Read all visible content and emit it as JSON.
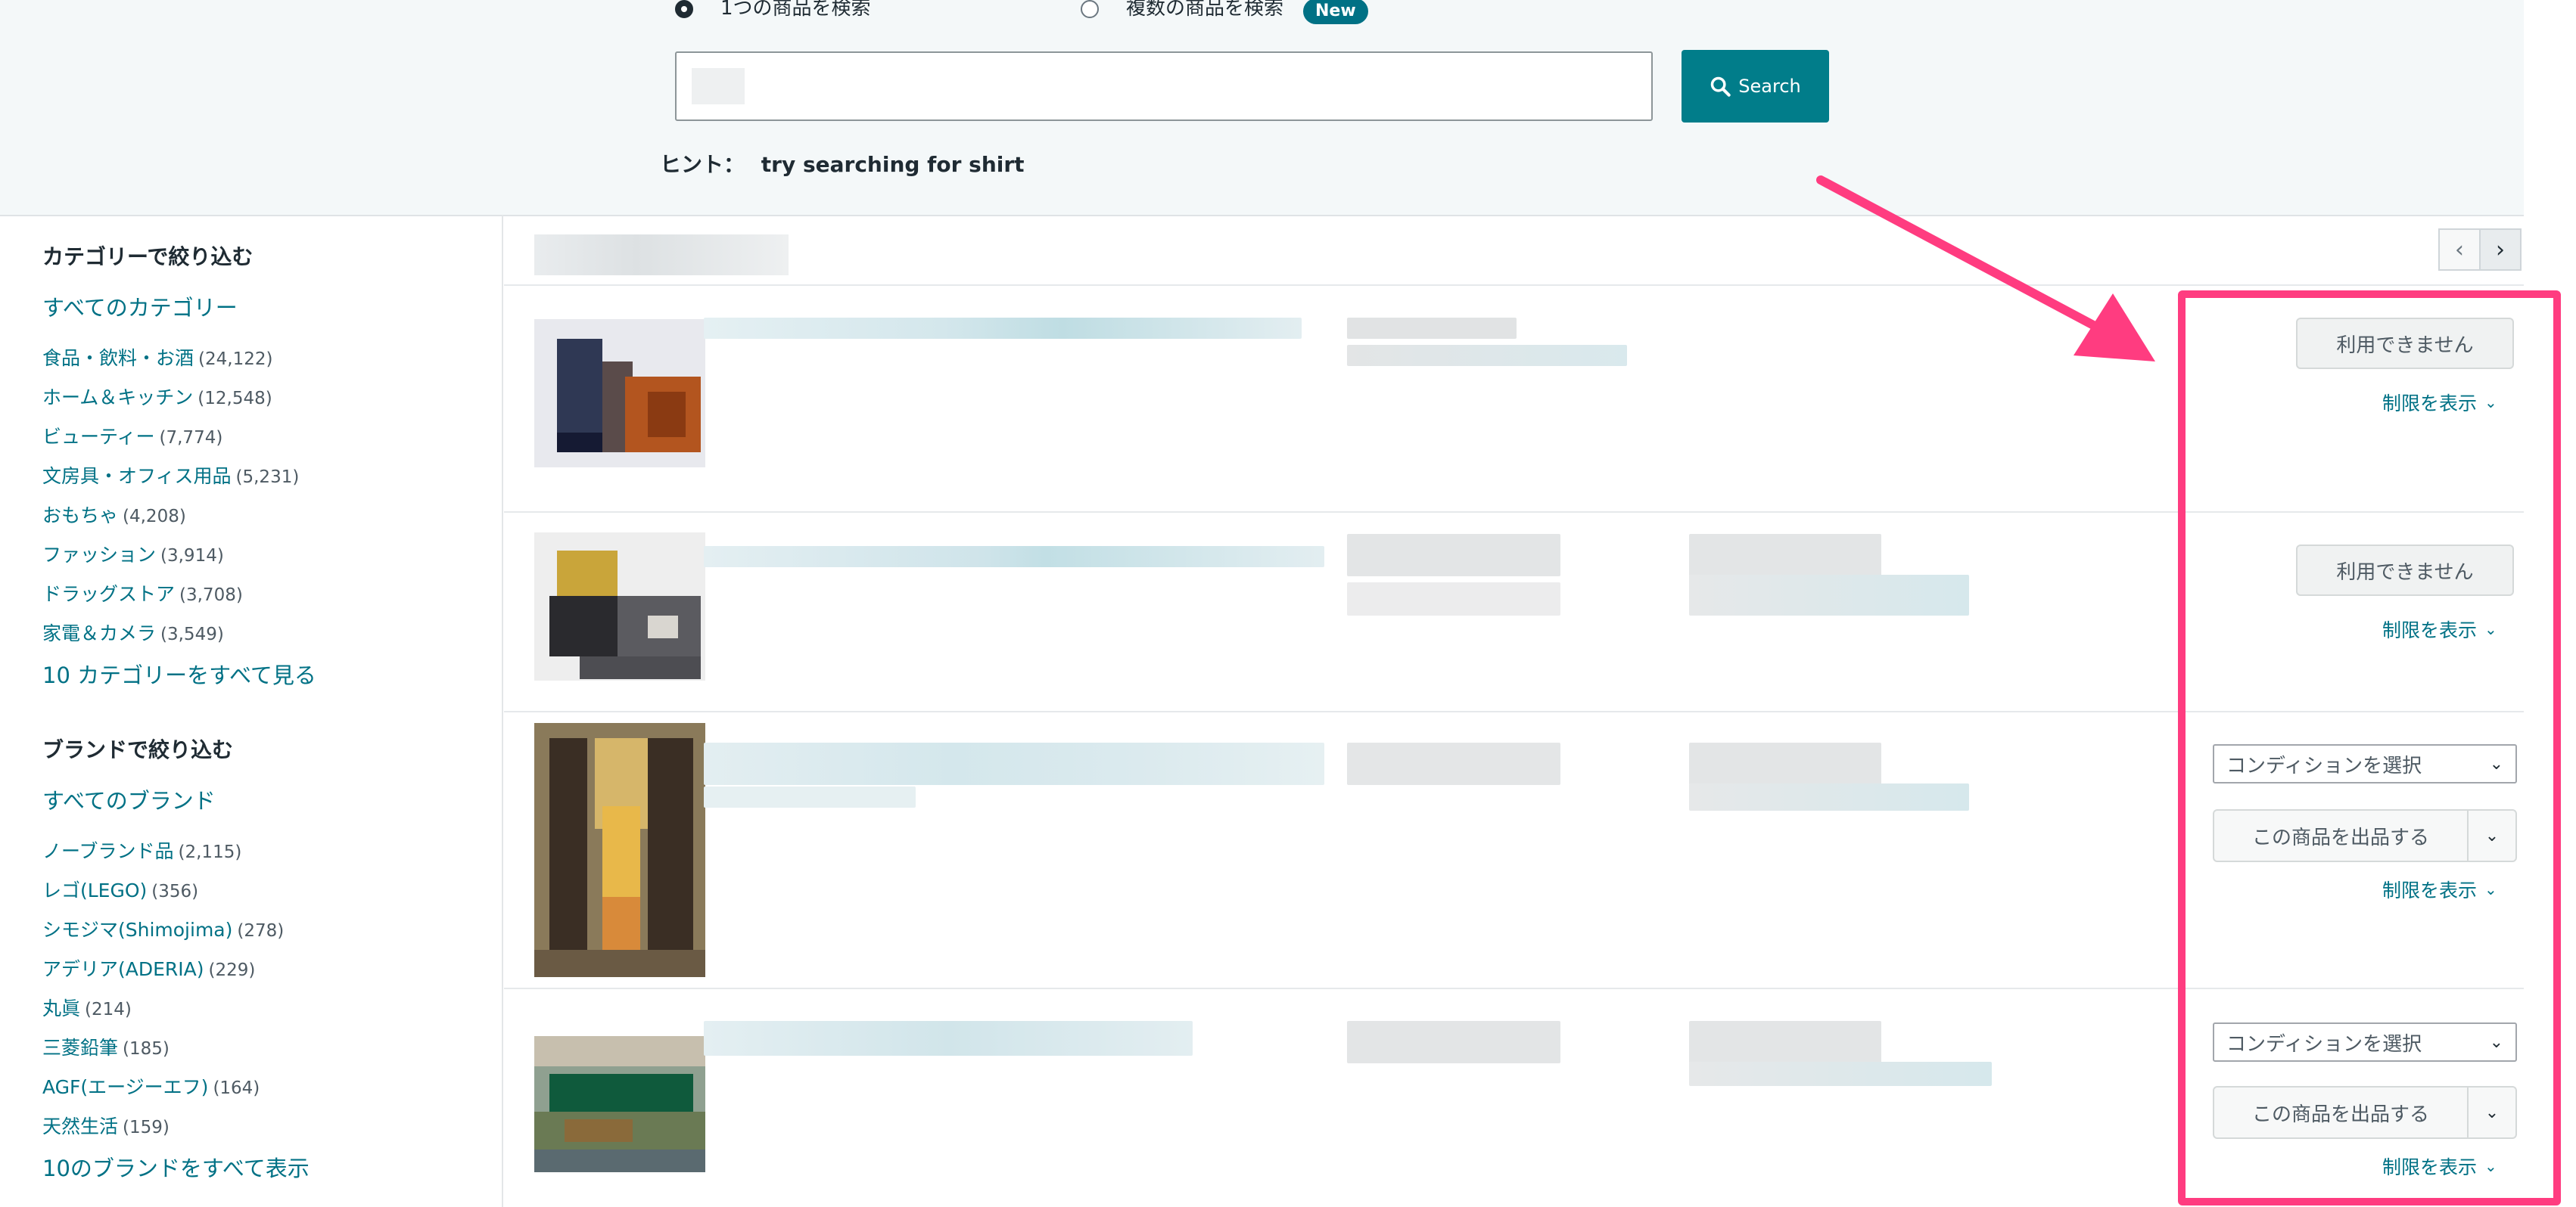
{
  "search": {
    "single_label": "1つの商品を検索",
    "multi_label": "複数の商品を検索",
    "new_badge": "New",
    "button_label": "Search",
    "hint_prefix": "ヒント：",
    "hint_text": "try searching for shirt"
  },
  "sidebar": {
    "category_heading": "カテゴリーで絞り込む",
    "all_categories": "すべてのカテゴリー",
    "categories": [
      {
        "label": "食品・飲料・お酒",
        "count": "(24,122)"
      },
      {
        "label": "ホーム＆キッチン",
        "count": "(12,548)"
      },
      {
        "label": "ビューティー",
        "count": "(7,774)"
      },
      {
        "label": "文房具・オフィス用品",
        "count": "(5,231)"
      },
      {
        "label": "おもちゃ",
        "count": "(4,208)"
      },
      {
        "label": "ファッション",
        "count": "(3,914)"
      },
      {
        "label": "ドラッグストア",
        "count": "(3,708)"
      },
      {
        "label": "家電＆カメラ",
        "count": "(3,549)"
      }
    ],
    "see_all_categories": "10 カテゴリーをすべて見る",
    "brand_heading": "ブランドで絞り込む",
    "all_brands": "すべてのブランド",
    "brands": [
      {
        "label": "ノーブランド品",
        "count": "(2,115)"
      },
      {
        "label": "レゴ(LEGO)",
        "count": "(356)"
      },
      {
        "label": "シモジマ(Shimojima)",
        "count": "(278)"
      },
      {
        "label": "アデリア(ADERIA)",
        "count": "(229)"
      },
      {
        "label": "丸眞",
        "count": "(214)"
      },
      {
        "label": "三菱鉛筆",
        "count": "(185)"
      },
      {
        "label": "AGF(エージーエフ)",
        "count": "(164)"
      },
      {
        "label": "天然生活",
        "count": "(159)"
      }
    ],
    "see_all_brands": "10のブランドをすべて表示"
  },
  "results": {
    "unavailable_label": "利用できません",
    "show_limits_label": "制限を表示",
    "condition_placeholder": "コンディションを選択",
    "list_button_label": "この商品を出品する"
  },
  "colors": {
    "accent": "#007185",
    "search_button": "#017d8a",
    "highlight": "#ff3c80"
  }
}
